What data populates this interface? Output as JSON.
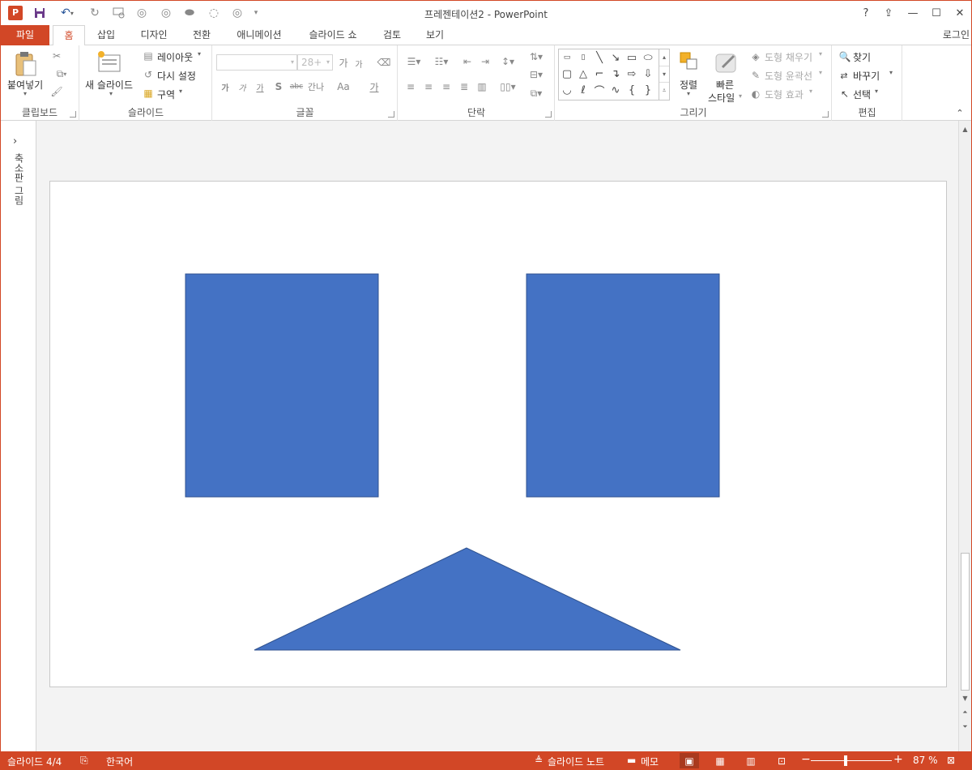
{
  "app": {
    "title": "프레젠테이션2 - PowerPoint",
    "icon_label": "P"
  },
  "window": {
    "help": "?",
    "restore_ribbon": "⇪",
    "minimize": "—",
    "maximize": "☐",
    "close": "✕"
  },
  "tabs": [
    {
      "label": "파일"
    },
    {
      "label": "홈"
    },
    {
      "label": "삽입"
    },
    {
      "label": "디자인"
    },
    {
      "label": "전환"
    },
    {
      "label": "애니메이션"
    },
    {
      "label": "슬라이드 쇼"
    },
    {
      "label": "검토"
    },
    {
      "label": "보기"
    }
  ],
  "login": "로그인",
  "ribbon": {
    "clipboard": {
      "paste": "붙여넣기",
      "label": "클립보드"
    },
    "slides": {
      "new_slide": "새 슬라이드",
      "layout": "레이아웃",
      "reset": "다시 설정",
      "section": "구역",
      "label": "슬라이드"
    },
    "font": {
      "font_size": "28+",
      "bold": "가",
      "italic": "가",
      "underline": "가",
      "shadow": "S",
      "strike": "abc",
      "spacing": "간나",
      "case": "Aa",
      "color": "가",
      "grow": "가",
      "shrink": "가",
      "label": "글꼴"
    },
    "paragraph": {
      "label": "단락"
    },
    "drawing": {
      "arrange": "정렬",
      "quick_styles_1": "빠른",
      "quick_styles_2": "스타일",
      "fill": "도형 채우기",
      "outline": "도형 윤곽선",
      "effects": "도형 효과",
      "label": "그리기"
    },
    "editing": {
      "find": "찾기",
      "replace": "바꾸기",
      "select": "선택",
      "label": "편집"
    }
  },
  "thumbnail_pane": {
    "label": "축소판 그림"
  },
  "slide": {
    "shapes": [
      {
        "type": "rectangle",
        "name": "left-eye"
      },
      {
        "type": "rectangle",
        "name": "right-eye"
      },
      {
        "type": "triangle",
        "name": "mouth"
      }
    ],
    "fill_color": "#4472c4",
    "stroke_color": "#2f528f"
  },
  "status": {
    "slide_counter": "슬라이드 4/4",
    "language": "한국어",
    "notes": "슬라이드 노트",
    "comments": "메모",
    "zoom": "87 %"
  },
  "colors": {
    "accent": "#d24726"
  }
}
